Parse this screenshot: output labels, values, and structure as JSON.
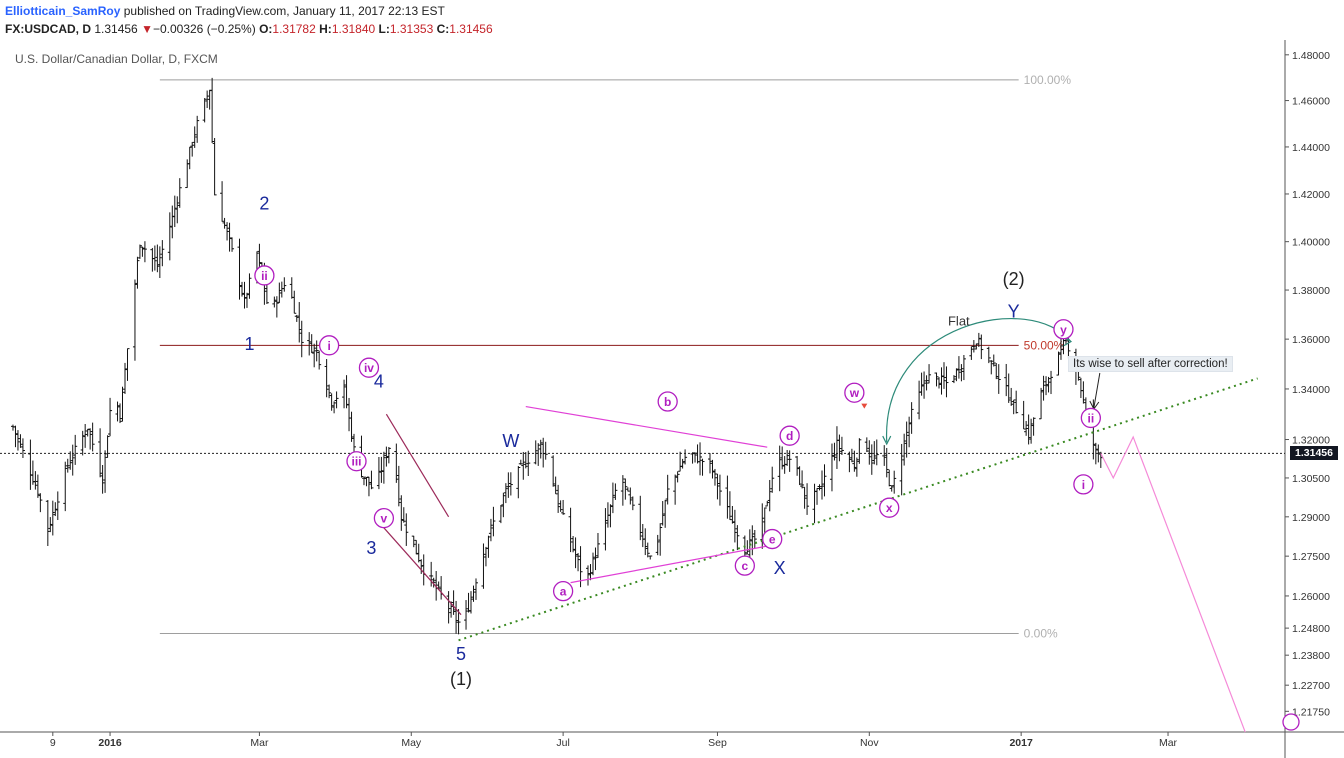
{
  "header": {
    "author": "Elliotticain_SamRoy",
    "published_text": "published on TradingView.com, January 11, 2017 22:13 EST",
    "symbol": "FX:USDCAD, D",
    "last": "1.31456",
    "down_arrow": "▼",
    "change": "−0.00326 (−0.25%)",
    "o_label": "O:",
    "o_value": "1.31782",
    "h_label": "H:",
    "h_value": "1.31840",
    "l_label": "L:",
    "l_value": "1.31353",
    "c_label": "C:",
    "c_value": "1.31456"
  },
  "chart_title": "U.S. Dollar/Canadian Dollar, D, FXCM",
  "last_price_tag": "1.31456",
  "note": "Its wise to sell after correction!",
  "chart_data": {
    "type": "ohlc-bar",
    "symbol": "FX:USDCAD",
    "timeframe": "D",
    "y_scale": "log",
    "ylim": [
      1.214,
      1.483
    ],
    "y_ticks": [
      1.48,
      1.46,
      1.44,
      1.42,
      1.4,
      1.38,
      1.36,
      1.34,
      1.32,
      1.305,
      1.29,
      1.275,
      1.26,
      1.248,
      1.238,
      1.227,
      1.2175
    ],
    "y_tick_labels": [
      "1.48000",
      "1.46000",
      "1.44000",
      "1.42000",
      "1.40000",
      "1.38000",
      "1.36000",
      "1.34000",
      "1.32000",
      "1.30500",
      "1.29000",
      "1.27500",
      "1.26000",
      "1.24800",
      "1.23800",
      "1.22700",
      "1.21750"
    ],
    "x_ticks": [
      "9",
      "2016",
      "Mar",
      "May",
      "Jul",
      "Sep",
      "Nov",
      "2017",
      "Mar"
    ],
    "x_tick_dates": [
      "2015-12-09",
      "2016-01-01",
      "2016-03-01",
      "2016-05-01",
      "2016-07-01",
      "2016-09-01",
      "2016-11-01",
      "2017-01-01",
      "2017-03-01"
    ],
    "last_price": 1.31456,
    "price_path": [
      [
        "2015-11-23",
        1.325
      ],
      [
        "2015-12-03",
        1.3
      ],
      [
        "2015-12-07",
        1.285
      ],
      [
        "2015-12-15",
        1.31
      ],
      [
        "2015-12-23",
        1.325
      ],
      [
        "2015-12-29",
        1.305
      ],
      [
        "2016-01-02",
        1.34
      ],
      [
        "2016-01-05",
        1.33
      ],
      [
        "2016-01-13",
        1.4
      ],
      [
        "2016-01-20",
        1.39
      ],
      [
        "2016-01-26",
        1.41
      ],
      [
        "2016-02-05",
        1.45
      ],
      [
        "2016-02-10",
        1.465
      ],
      [
        "2016-02-12",
        1.42
      ],
      [
        "2016-02-18",
        1.4
      ],
      [
        "2016-02-24",
        1.375
      ],
      [
        "2016-02-29",
        1.395
      ],
      [
        "2016-03-05",
        1.37
      ],
      [
        "2016-03-12",
        1.385
      ],
      [
        "2016-03-18",
        1.36
      ],
      [
        "2016-03-24",
        1.355
      ],
      [
        "2016-03-30",
        1.335
      ],
      [
        "2016-04-04",
        1.34
      ],
      [
        "2016-04-09",
        1.31
      ],
      [
        "2016-04-16",
        1.3
      ],
      [
        "2016-04-23",
        1.32
      ],
      [
        "2016-04-27",
        1.29
      ],
      [
        "2016-05-06",
        1.27
      ],
      [
        "2016-05-13",
        1.26
      ],
      [
        "2016-05-20",
        1.25
      ],
      [
        "2016-05-23",
        1.253
      ],
      [
        "2016-06-01",
        1.283
      ],
      [
        "2016-06-08",
        1.3
      ],
      [
        "2016-06-15",
        1.31
      ],
      [
        "2016-06-22",
        1.318
      ],
      [
        "2016-06-25",
        1.312
      ],
      [
        "2016-06-29",
        1.295
      ],
      [
        "2016-07-06",
        1.275
      ],
      [
        "2016-07-10",
        1.265
      ],
      [
        "2016-07-17",
        1.284
      ],
      [
        "2016-07-24",
        1.306
      ],
      [
        "2016-07-30",
        1.29
      ],
      [
        "2016-08-06",
        1.272
      ],
      [
        "2016-08-12",
        1.3
      ],
      [
        "2016-08-20",
        1.315
      ],
      [
        "2016-08-29",
        1.31
      ],
      [
        "2016-09-06",
        1.29
      ],
      [
        "2016-09-12",
        1.278
      ],
      [
        "2016-09-18",
        1.283
      ],
      [
        "2016-09-24",
        1.31
      ],
      [
        "2016-10-01",
        1.313
      ],
      [
        "2016-10-07",
        1.295
      ],
      [
        "2016-10-12",
        1.3
      ],
      [
        "2016-10-19",
        1.318
      ],
      [
        "2016-10-26",
        1.31
      ],
      [
        "2016-10-29",
        1.322
      ],
      [
        "2016-11-02",
        1.312
      ],
      [
        "2016-11-06",
        1.315
      ],
      [
        "2016-11-10",
        1.3
      ],
      [
        "2016-11-18",
        1.33
      ],
      [
        "2016-11-24",
        1.345
      ],
      [
        "2016-12-03",
        1.342
      ],
      [
        "2016-12-08",
        1.35
      ],
      [
        "2016-12-14",
        1.36
      ],
      [
        "2016-12-19",
        1.352
      ],
      [
        "2016-12-23",
        1.345
      ],
      [
        "2016-12-31",
        1.33
      ],
      [
        "2017-01-04",
        1.322
      ],
      [
        "2017-01-09",
        1.338
      ],
      [
        "2017-01-16",
        1.353
      ],
      [
        "2017-01-19",
        1.36
      ],
      [
        "2017-01-24",
        1.345
      ],
      [
        "2017-01-28",
        1.325
      ],
      [
        "2017-01-31",
        1.315
      ],
      [
        "2017-02-02",
        1.31456
      ]
    ],
    "fib_levels": [
      {
        "label": "100.00%",
        "price": 1.469,
        "color": "#9e9e9e"
      },
      {
        "label": "50.00%",
        "price": 1.3575,
        "color": "#8b1a1a"
      },
      {
        "label": "0.00%",
        "price": 1.246,
        "color": "#9e9e9e"
      }
    ],
    "trendline": {
      "from": [
        "2016-05-20",
        1.2435
      ],
      "to": [
        "2017-04-06",
        1.3442
      ],
      "style": "dotted",
      "color": "#3a8a22"
    },
    "projection": [
      [
        "2017-02-02",
        1.31456
      ],
      [
        "2017-02-07",
        1.305
      ],
      [
        "2017-02-15",
        1.321
      ],
      [
        "2017-04-01",
        1.21
      ]
    ],
    "flat_arc": {
      "from": [
        "2016-11-08",
        1.319
      ],
      "to": [
        "2017-01-21",
        1.359
      ],
      "label": "Flat"
    },
    "triangle_upper": {
      "from": [
        "2016-06-16",
        1.333
      ],
      "to": [
        "2016-09-21",
        1.317
      ]
    },
    "triangle_lower": {
      "from": [
        "2016-07-04",
        1.265
      ],
      "to": [
        "2016-09-22",
        1.279
      ]
    },
    "wave3_channel": [
      {
        "from": [
          "2016-04-21",
          1.33
        ],
        "to": [
          "2016-05-16",
          1.29
        ]
      },
      {
        "from": [
          "2016-04-17",
          1.289
        ],
        "to": [
          "2016-05-21",
          1.253
        ]
      }
    ],
    "wave_labels": [
      {
        "text": "1",
        "date": "2016-02-26",
        "price": 1.358,
        "style": "primary"
      },
      {
        "text": "2",
        "date": "2016-03-03",
        "price": 1.416,
        "style": "primary"
      },
      {
        "text": "3",
        "date": "2016-04-15",
        "price": 1.278,
        "style": "primary"
      },
      {
        "text": "4",
        "date": "2016-04-18",
        "price": 1.343,
        "style": "primary"
      },
      {
        "text": "5",
        "date": "2016-05-21",
        "price": 1.2385,
        "style": "primary"
      },
      {
        "text": "(1)",
        "date": "2016-05-21",
        "price": 1.2292,
        "style": "major"
      },
      {
        "text": "(2)",
        "date": "2016-12-29",
        "price": 1.3845,
        "style": "major"
      },
      {
        "text": "W",
        "date": "2016-06-10",
        "price": 1.3195,
        "style": "primary"
      },
      {
        "text": "X",
        "date": "2016-09-26",
        "price": 1.2705,
        "style": "primary"
      },
      {
        "text": "Y",
        "date": "2016-12-29",
        "price": 1.3712,
        "style": "primary"
      },
      {
        "text": "i",
        "date": "2016-03-29",
        "price": 1.3575,
        "style": "circled"
      },
      {
        "text": "ii",
        "date": "2016-03-03",
        "price": 1.386,
        "style": "circled"
      },
      {
        "text": "iii",
        "date": "2016-04-09",
        "price": 1.3115,
        "style": "circled"
      },
      {
        "text": "iv",
        "date": "2016-04-14",
        "price": 1.3485,
        "style": "circled"
      },
      {
        "text": "v",
        "date": "2016-04-20",
        "price": 1.2895,
        "style": "circled"
      },
      {
        "text": "a",
        "date": "2016-07-01",
        "price": 1.2618,
        "style": "circled"
      },
      {
        "text": "b",
        "date": "2016-08-12",
        "price": 1.335,
        "style": "circled"
      },
      {
        "text": "c",
        "date": "2016-09-12",
        "price": 1.2714,
        "style": "circled"
      },
      {
        "text": "d",
        "date": "2016-09-30",
        "price": 1.3215,
        "style": "circled"
      },
      {
        "text": "e",
        "date": "2016-09-23",
        "price": 1.2815,
        "style": "circled"
      },
      {
        "text": "w",
        "date": "2016-10-26",
        "price": 1.3385,
        "style": "circled"
      },
      {
        "text": "x",
        "date": "2016-11-09",
        "price": 1.2935,
        "style": "circled"
      },
      {
        "text": "y",
        "date": "2017-01-18",
        "price": 1.364,
        "style": "circled"
      },
      {
        "text": "i",
        "date": "2017-01-26",
        "price": 1.3025,
        "style": "circled"
      },
      {
        "text": "ii",
        "date": "2017-01-29",
        "price": 1.3285,
        "style": "circled"
      }
    ]
  }
}
